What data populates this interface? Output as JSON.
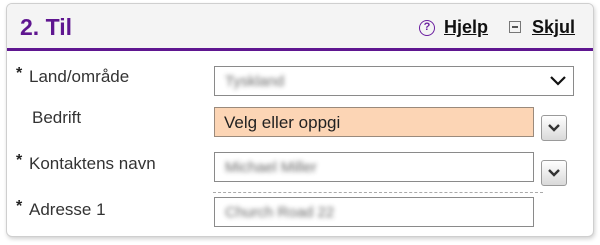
{
  "section": {
    "title": "2. Til",
    "help_label": "Hjelp",
    "hide_label": "Skjul"
  },
  "fields": {
    "country": {
      "label": "Land/område",
      "required_mark": "*",
      "value": "Tyskland"
    },
    "company": {
      "label": "Bedrift",
      "placeholder": "Velg eller oppgi"
    },
    "contact_name": {
      "label": "Kontaktens navn",
      "required_mark": "*",
      "value": "Michael Miller"
    },
    "address1": {
      "label": "Adresse 1",
      "required_mark": "*",
      "value": "Church Road 22"
    }
  },
  "colors": {
    "accent": "#5f1690",
    "highlight_field": "#fcd5b5"
  },
  "icons": {
    "help": "question-circle-icon",
    "hide": "collapse-box-icon",
    "dropdown": "chevron-down-icon"
  }
}
